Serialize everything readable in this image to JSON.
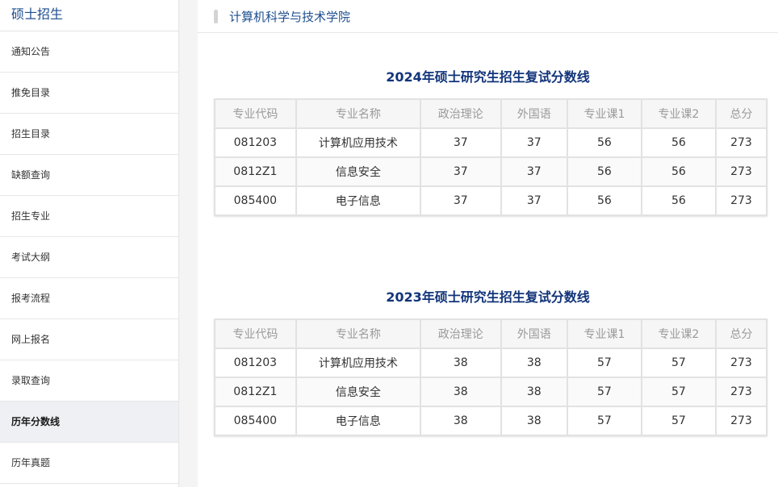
{
  "sidebar": {
    "title": "硕士招生",
    "items": [
      {
        "label": "通知公告",
        "active": false
      },
      {
        "label": "推免目录",
        "active": false
      },
      {
        "label": "招生目录",
        "active": false
      },
      {
        "label": "缺额查询",
        "active": false
      },
      {
        "label": "招生专业",
        "active": false
      },
      {
        "label": "考试大纲",
        "active": false
      },
      {
        "label": "报考流程",
        "active": false
      },
      {
        "label": "网上报名",
        "active": false
      },
      {
        "label": "录取查询",
        "active": false
      },
      {
        "label": "历年分数线",
        "active": true
      },
      {
        "label": "历年真题",
        "active": false
      }
    ]
  },
  "header": {
    "title": "计算机科学与技术学院"
  },
  "columns": [
    "专业代码",
    "专业名称",
    "政治理论",
    "外国语",
    "专业课1",
    "专业课2",
    "总分"
  ],
  "tables": [
    {
      "title": "2024年硕士研究生招生复试分数线",
      "rows": [
        [
          "081203",
          "计算机应用技术",
          "37",
          "37",
          "56",
          "56",
          "273"
        ],
        [
          "0812Z1",
          "信息安全",
          "37",
          "37",
          "56",
          "56",
          "273"
        ],
        [
          "085400",
          "电子信息",
          "37",
          "37",
          "56",
          "56",
          "273"
        ]
      ]
    },
    {
      "title": "2023年硕士研究生招生复试分数线",
      "rows": [
        [
          "081203",
          "计算机应用技术",
          "38",
          "38",
          "57",
          "57",
          "273"
        ],
        [
          "0812Z1",
          "信息安全",
          "38",
          "38",
          "57",
          "57",
          "273"
        ],
        [
          "085400",
          "电子信息",
          "38",
          "38",
          "57",
          "57",
          "273"
        ]
      ]
    }
  ]
}
